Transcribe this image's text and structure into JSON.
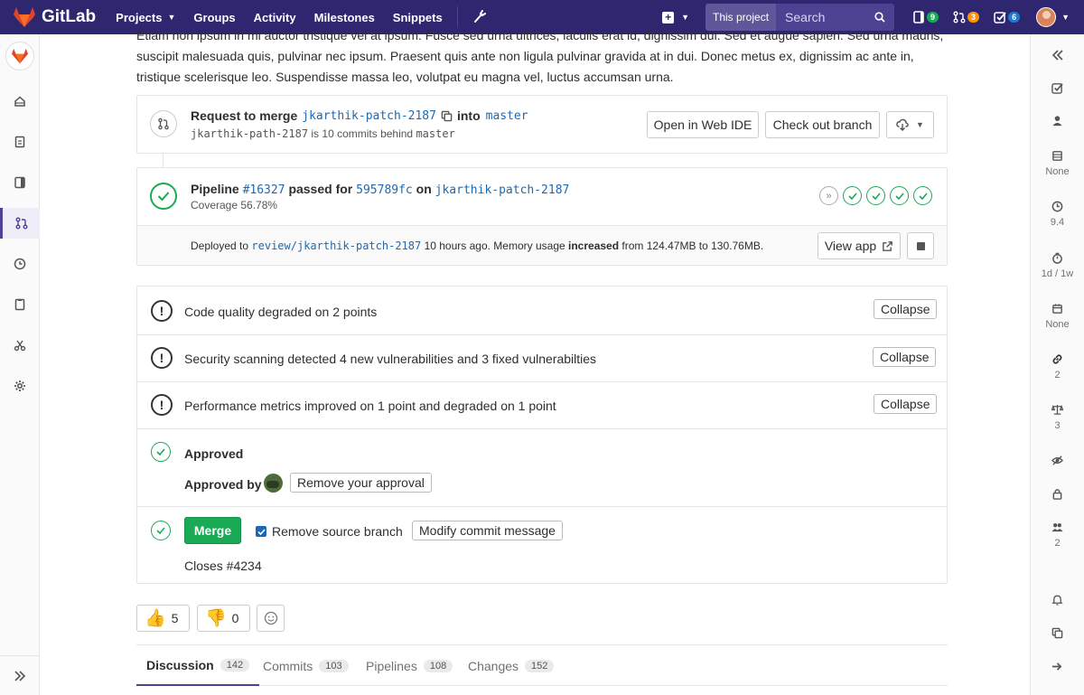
{
  "navbar": {
    "brand": "GitLab",
    "links": [
      "Projects",
      "Groups",
      "Activity",
      "Milestones",
      "Snippets"
    ],
    "search_scope": "This project",
    "search_placeholder": "Search",
    "todos_count": "9",
    "mr_count": "3",
    "issues_count": "6",
    "colors": {
      "bg": "#2e2770",
      "todo_badge": "#1aaa55",
      "mr_badge": "#fc9403",
      "issue_badge": "#1f78d1"
    }
  },
  "description": "Etiam non ipsum in mi auctor tristique vel at ipsum. Fusce sed urna ultrices, iaculis erat id, dignissim dui. Sed et augue sapien. Sed urna mauris, suscipit malesuada quis, pulvinar nec ipsum. Praesent quis ante non ligula pulvinar gravida at in dui. Donec metus ex, dignissim ac ante in, tristique scelerisque leo. Suspendisse massa leo, volutpat eu magna vel, luctus accumsan urna.",
  "merge_request": {
    "request_label": "Request to merge",
    "source_branch": "jkarthik-patch-2187",
    "into_label": "into",
    "target_branch": "master",
    "behind_branch": "jkarthik-path-2187",
    "behind_text": "is 10 commits behind",
    "behind_target": "master",
    "open_web_ide": "Open in Web IDE",
    "check_out_branch": "Check out branch"
  },
  "pipeline": {
    "label": "Pipeline",
    "id": "#16327",
    "passed_for": "passed for",
    "commit": "595789fc",
    "on": "on",
    "branch": "jkarthik-patch-2187",
    "coverage": "Coverage 56.78%",
    "stages": [
      "skipped",
      "passed",
      "passed",
      "passed",
      "passed"
    ]
  },
  "deployment": {
    "prefix": "Deployed to",
    "env": "review/jkarthik-patch-2187",
    "middle": "10 hours ago. Memory usage",
    "trend": "increased",
    "suffix": "from 124.47MB to 130.76MB.",
    "view_app": "View app"
  },
  "reports": [
    {
      "text": "Code quality degraded on 2 points",
      "button": "Collapse"
    },
    {
      "text": "Security scanning detected 4 new vulnerabilities and 3 fixed vulnerabilties",
      "button": "Collapse"
    },
    {
      "text": "Performance metrics improved on 1 point and degraded on 1 point",
      "button": "Collapse"
    }
  ],
  "approval": {
    "title": "Approved",
    "approved_by": "Approved by",
    "remove": "Remove your approval"
  },
  "merge": {
    "button": "Merge",
    "remove_source": "Remove source branch",
    "modify": "Modify commit message",
    "closes": "Closes #4234"
  },
  "awards": {
    "thumbs_up": "5",
    "thumbs_down": "0"
  },
  "tabs": [
    {
      "label": "Discussion",
      "count": "142"
    },
    {
      "label": "Commits",
      "count": "103"
    },
    {
      "label": "Pipelines",
      "count": "108"
    },
    {
      "label": "Changes",
      "count": "152"
    }
  ],
  "right_sidebar": {
    "labels_value": "None",
    "time_value": "9.4",
    "estimate_value": "1d / 1w",
    "due_value": "None",
    "links_value": "2",
    "weight_value": "3",
    "participants_value": "2"
  }
}
